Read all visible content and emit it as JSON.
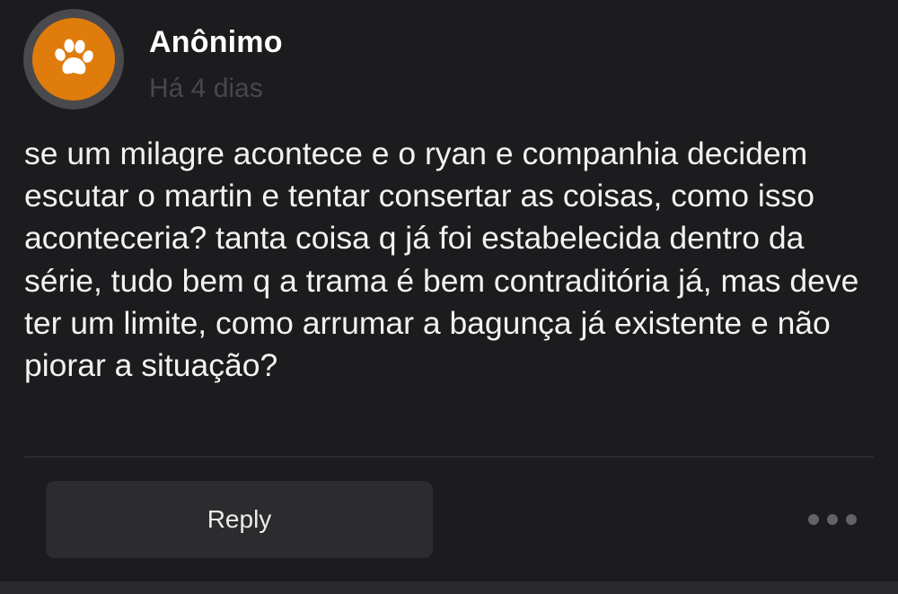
{
  "post": {
    "author": "Anônimo",
    "timestamp": "Há 4 dias",
    "body": "se um milagre acontece e o ryan e companhia decidem escutar o martin e tentar consertar as coisas, como isso aconteceria? tanta coisa q já foi estabelecida dentro da série, tudo bem q a trama é bem contraditória já, mas deve ter um limite, como arrumar a bagunça já existente e não piorar a situação?",
    "avatar_icon": "paw-icon"
  },
  "actions": {
    "reply_label": "Reply",
    "more_icon": "more-dots-icon"
  },
  "colors": {
    "background": "#1c1c1e",
    "avatar": "#e07c0c",
    "avatar_ring": "#4a4a4c",
    "timestamp": "#48484a",
    "button_bg": "#2c2c2e"
  }
}
